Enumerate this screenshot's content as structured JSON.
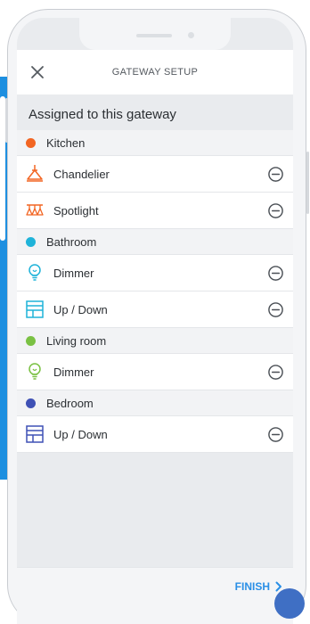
{
  "header": {
    "title": "GATEWAY SETUP"
  },
  "section": {
    "title": "Assigned to this gateway"
  },
  "groups": [
    {
      "name": "Kitchen",
      "color": "#f26522",
      "devices": [
        {
          "label": "Chandelier",
          "icon": "chandelier-icon"
        },
        {
          "label": "Spotlight",
          "icon": "spotlight-icon"
        }
      ]
    },
    {
      "name": "Bathroom",
      "color": "#1fb3d9",
      "devices": [
        {
          "label": "Dimmer",
          "icon": "bulb-icon"
        },
        {
          "label": "Up / Down",
          "icon": "shutter-icon"
        }
      ]
    },
    {
      "name": "Living room",
      "color": "#7ac143",
      "devices": [
        {
          "label": "Dimmer",
          "icon": "bulb-icon"
        }
      ]
    },
    {
      "name": "Bedroom",
      "color": "#3f51b5",
      "devices": [
        {
          "label": "Up / Down",
          "icon": "shutter-icon"
        }
      ]
    }
  ],
  "footer": {
    "finish_label": "FINISH"
  },
  "colors": {
    "accent": "#2a8fe6",
    "screen_bg": "#e9ebee"
  }
}
